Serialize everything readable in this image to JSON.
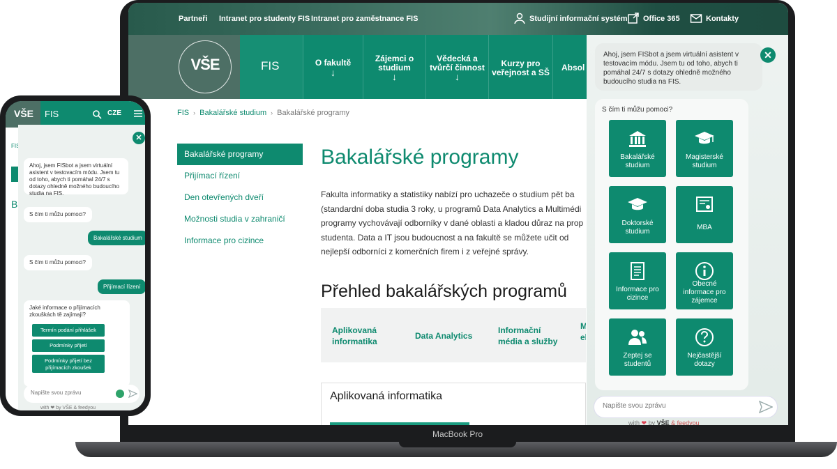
{
  "laptop": {
    "model_label": "MacBook Pro",
    "topbar": {
      "partners": "Partneři",
      "intranet_students": "Intranet pro studenty FIS",
      "intranet_staff": "Intranet pro zaměstnance FIS",
      "study_system": "Studijní informační systém",
      "office": "Office 365",
      "contacts": "Kontakty"
    },
    "logo_text": "VŠE",
    "nav": {
      "fis": "FIS",
      "items": [
        {
          "label": "O fakultě",
          "arrow": "↓"
        },
        {
          "label": "Zájemci o studium",
          "arrow": "↓"
        },
        {
          "label": "Vědecká a tvůrčí činnost",
          "arrow": "↓"
        },
        {
          "label": "Kurzy pro veřejnost a SŠ",
          "arrow": ""
        },
        {
          "label": "Absol",
          "arrow": ""
        }
      ]
    },
    "breadcrumb": {
      "items": [
        "FIS",
        "Bakalářské studium",
        "Bakalářské programy"
      ],
      "separator": "›"
    },
    "sidebar": {
      "items": [
        {
          "label": "Bakalářské programy"
        },
        {
          "label": "Přijímací řízení"
        },
        {
          "label": "Den otevřených dveří"
        },
        {
          "label": "Možnosti studia v zahraničí"
        },
        {
          "label": "Informace pro cizince"
        }
      ]
    },
    "page_title": "Bakalářské programy",
    "intro": "Fakulta informatiky a statistiky nabízí pro uchazeče o studium pět ba (standardní doba studia 3 roky, u programů Data Analytics a Multimédi programy vychovávají odborníky v dané oblasti a kladou důraz na prop studenta. Data a IT jsou budoucnost a na fakultě se můžete učit od nejlepší odborníci z komerčních firem i z veřejné správy.",
    "overview_title": "Přehled bakalářských programů",
    "program_tabs": [
      "Aplikovaná informatika",
      "Data Analytics",
      "Informační média a služby",
      "M el"
    ],
    "card_title": "Aplikovaná informatika",
    "chatbot": {
      "greeting": "Ahoj, jsem FISbot a jsem virtuální asistent v testovacím módu. Jsem tu od toho, abych ti pomáhal 24/7 s dotazy ohledně možného budoucího studia na FIS.",
      "close": "✕",
      "question": "S čím ti můžu pomoci?",
      "tiles": [
        {
          "label": "Bakalářské studium",
          "icon": "bank-icon"
        },
        {
          "label": "Magisterské studium",
          "icon": "graduation-cap-icon"
        },
        {
          "label": "Doktorské studium",
          "icon": "graduation-cap-icon"
        },
        {
          "label": "MBA",
          "icon": "certificate-icon"
        },
        {
          "label": "Informace pro cizince",
          "icon": "document-icon"
        },
        {
          "label": "Obecné informace pro zájemce",
          "icon": "info-icon"
        },
        {
          "label": "Zeptej se studentů",
          "icon": "users-icon"
        },
        {
          "label": "Nejčastější dotazy",
          "icon": "question-icon"
        }
      ],
      "input_placeholder": "Napište svou zprávu",
      "credit_prefix": "with",
      "credit_by": "by",
      "credit_vse": "VŠE",
      "credit_partner": "& feedyou"
    }
  },
  "phone": {
    "logo_text": "VŠE",
    "fis": "FIS",
    "lang": "CZE",
    "bg_crumb": "FIS",
    "bg_heading": "B",
    "chat": {
      "close": "✕",
      "greeting": "Ahoj, jsem FISbot a jsem virtuální asistent v testovacím módu. Jsem tu od toho, abych ti pomáhal 24/7 s dotazy ohledně možného budoucího studia na FIS.",
      "question1": "S čím ti můžu pomoci?",
      "user1": "Bakalářské studium",
      "question2": "S čím ti můžu pomoci?",
      "user2": "Přijímací řízení",
      "question3": "Jaké informace o přijímacích zkouškách tě zajímají?",
      "options": [
        "Termín podání přihlášek",
        "Podmínky přijetí",
        "Podmínky přijetí bez přijímacích zkoušek"
      ],
      "input_placeholder": "Napište svou zprávu",
      "credit": "with ❤ by VŠE & feedyou"
    }
  },
  "colors": {
    "brand_green": "#0e8a6f",
    "topbar_dark": "#1e4c40",
    "logo_bg": "#4d6f65",
    "device_body": "#1b1c1e"
  }
}
